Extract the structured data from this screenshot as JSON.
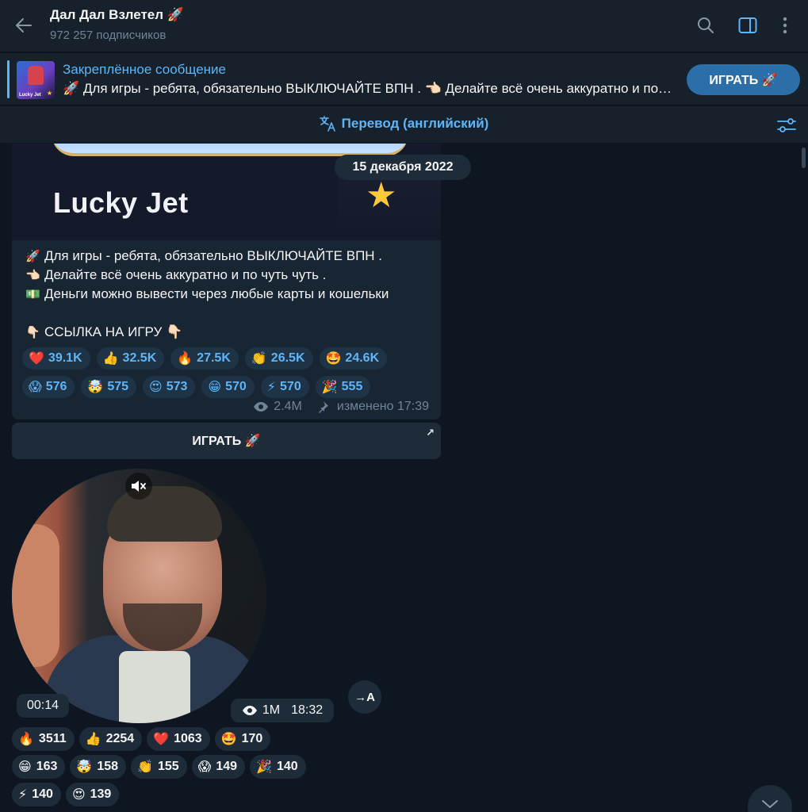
{
  "header": {
    "title": "Дал Дал Взлетел 🚀",
    "subtitle": "972 257 подписчиков"
  },
  "pinned": {
    "title": "Закреплённое сообщение",
    "text": "🚀 Для игры - ребята, обязательно ВЫКЛЮЧАЙТЕ ВПН . 👈🏻 Делайте всё очень аккуратно и по чуть чуть .",
    "thumb_label": "Lucky Jet",
    "button": "ИГРАТЬ 🚀"
  },
  "translate": {
    "label": "Перевод (английский)"
  },
  "date_pill": "15 декабря 2022",
  "post": {
    "image_title": "Lucky Jet",
    "lines": [
      {
        "emoji": "🚀",
        "text": "Для игры - ребята, обязательно ВЫКЛЮЧАЙТЕ ВПН ."
      },
      {
        "emoji": "👈🏻",
        "text": "Делайте всё очень аккуратно и по чуть чуть ."
      },
      {
        "emoji": "💵",
        "text": "Деньги можно вывести через любые карты и кошельки"
      },
      {
        "emoji": "",
        "text": ""
      },
      {
        "emoji": "👇🏻",
        "text": "ССЫЛКА НА ИГРУ 👇🏻"
      }
    ],
    "reactions": [
      {
        "emoji": "❤️",
        "count": "39.1K"
      },
      {
        "emoji": "👍",
        "count": "32.5K"
      },
      {
        "emoji": "🔥",
        "count": "27.5K"
      },
      {
        "emoji": "👏",
        "count": "26.5K"
      },
      {
        "emoji": "🤩",
        "count": "24.6K"
      },
      {
        "emoji": "😱",
        "count": "576"
      },
      {
        "emoji": "🤯",
        "count": "575"
      },
      {
        "emoji": "😍",
        "count": "573"
      },
      {
        "emoji": "😁",
        "count": "570"
      },
      {
        "emoji": "⚡",
        "count": "570"
      },
      {
        "emoji": "🎉",
        "count": "555"
      }
    ],
    "views": "2.4M",
    "edited": "изменено 17:39",
    "button": "ИГРАТЬ 🚀"
  },
  "video": {
    "duration": "00:14",
    "views": "1M",
    "time": "18:32",
    "translate_icon_label": "→A",
    "reactions": [
      {
        "emoji": "🔥",
        "count": "3511"
      },
      {
        "emoji": "👍",
        "count": "2254"
      },
      {
        "emoji": "❤️",
        "count": "1063"
      },
      {
        "emoji": "🤩",
        "count": "170"
      },
      {
        "emoji": "😁",
        "count": "163"
      },
      {
        "emoji": "🤯",
        "count": "158"
      },
      {
        "emoji": "👏",
        "count": "155"
      },
      {
        "emoji": "😱",
        "count": "149"
      },
      {
        "emoji": "🎉",
        "count": "140"
      },
      {
        "emoji": "⚡",
        "count": "140"
      },
      {
        "emoji": "😍",
        "count": "139"
      }
    ]
  },
  "colors": {
    "background": "#0e1621",
    "panel": "#17212b",
    "accent": "#5eb5f7",
    "button": "#2b6ea8"
  }
}
